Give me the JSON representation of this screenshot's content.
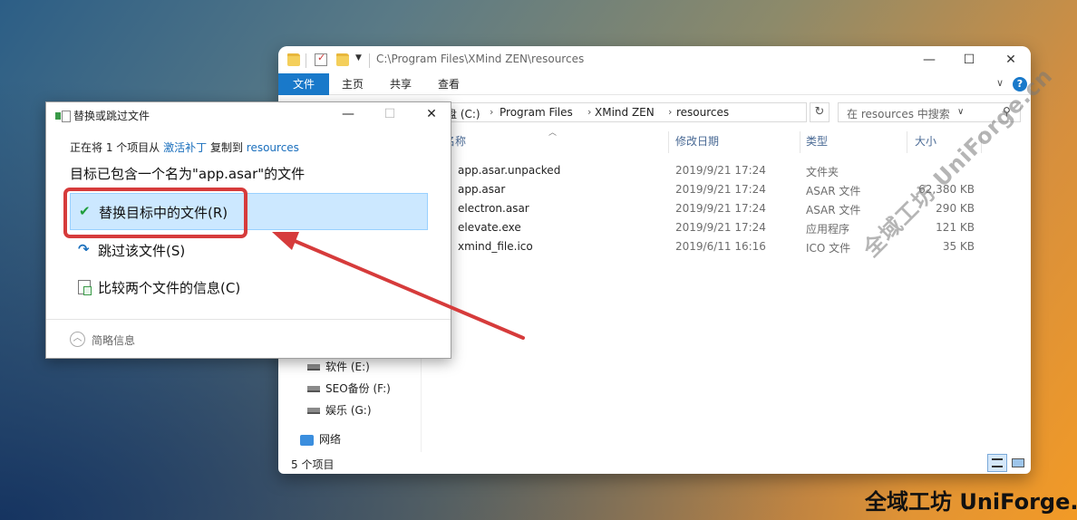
{
  "explorer": {
    "title_path": "C:\\Program Files\\XMind ZEN\\resources",
    "ribbon_tabs": [
      "文件",
      "主页",
      "共享",
      "查看"
    ],
    "breadcrumbs": [
      "盘 (C:)",
      "Program Files",
      "XMind ZEN",
      "resources"
    ],
    "search_placeholder": "在 resources 中搜索",
    "columns": [
      "名称",
      "修改日期",
      "类型",
      "大小"
    ],
    "files": [
      {
        "name": "app.asar.unpacked",
        "date": "2019/9/21 17:24",
        "type": "文件夹",
        "size": ""
      },
      {
        "name": "app.asar",
        "date": "2019/9/21 17:24",
        "type": "ASAR 文件",
        "size": "62,380 KB"
      },
      {
        "name": "electron.asar",
        "date": "2019/9/21 17:24",
        "type": "ASAR 文件",
        "size": "290 KB"
      },
      {
        "name": "elevate.exe",
        "date": "2019/9/21 17:24",
        "type": "应用程序",
        "size": "121 KB"
      },
      {
        "name": "xmind_file.ico",
        "date": "2019/6/11 16:16",
        "type": "ICO 文件",
        "size": "35 KB"
      }
    ],
    "sidebar": [
      "软件 (E:)",
      "SEO备份 (F:)",
      "娱乐 (G:)",
      "网络"
    ],
    "status": "5 个项目"
  },
  "dialog": {
    "title": "替换或跳过文件",
    "line1_prefix": "正在将 1 个项目从",
    "line1_source": "激活补丁",
    "line1_mid": "复制到",
    "line1_dest": "resources",
    "line2": "目标已包含一个名为\"app.asar\"的文件",
    "option_replace": "替换目标中的文件(R)",
    "option_skip": "跳过该文件(S)",
    "option_compare": "比较两个文件的信息(C)",
    "more_info": "简略信息"
  },
  "watermark": {
    "diagonal": "全域工坊 UniForge.cn",
    "corner": "全域工坊 UniForge.cn"
  },
  "colors": {
    "accent": "#1979ca",
    "highlight": "#d63b3b",
    "selection": "#cce8ff"
  }
}
